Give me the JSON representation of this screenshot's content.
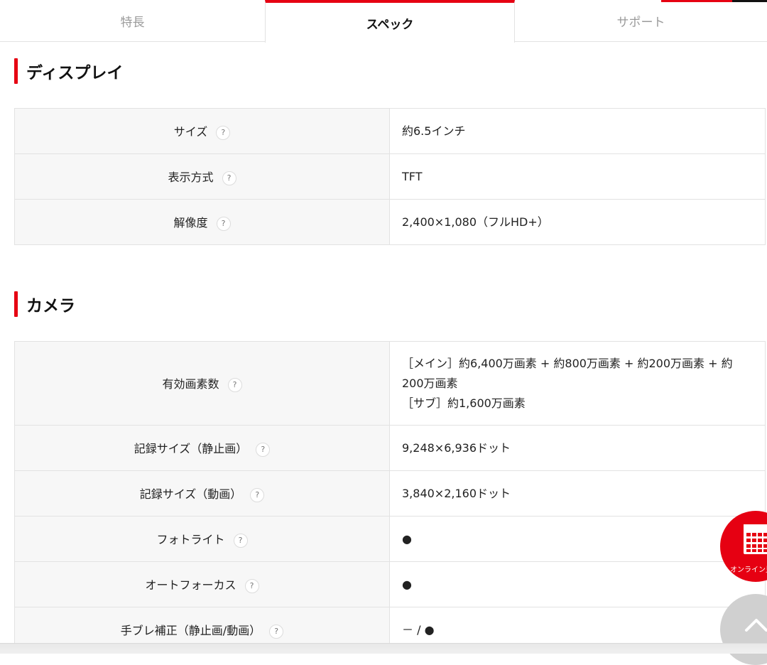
{
  "tabs": {
    "features": "特長",
    "spec": "スペック",
    "support": "サポート"
  },
  "sections": {
    "display": {
      "title": "ディスプレイ",
      "rows": [
        {
          "label": "サイズ",
          "value": "約6.5インチ"
        },
        {
          "label": "表示方式",
          "value": "TFT"
        },
        {
          "label": "解像度",
          "value": "2,400×1,080（フルHD+）"
        }
      ]
    },
    "camera": {
      "title": "カメラ",
      "rows": [
        {
          "label": "有効画素数",
          "value_lines": [
            "［メイン］約6,400万画素 + 約800万画素 + 約200万画素 + 約",
            "200万画素",
            "［サブ］約1,600万画素"
          ]
        },
        {
          "label": "記録サイズ（静止画）",
          "value": "9,248×6,936ドット"
        },
        {
          "label": "記録サイズ（動画）",
          "value": "3,840×2,160ドット"
        },
        {
          "label": "フォトライト",
          "value": "●"
        },
        {
          "label": "オートフォーカス",
          "value": "●"
        },
        {
          "label": "手ブレ補正（静止画/動画）",
          "value": "－ / ●"
        }
      ]
    }
  },
  "help_mark": "?",
  "floating": {
    "online_label": "オンライン見",
    "online_icon": "calendar-icon",
    "top_icon": "chevron-up-icon"
  },
  "colors": {
    "accent": "#e60012",
    "label_bg": "#f7f7f7",
    "border": "#e2e2e2"
  }
}
